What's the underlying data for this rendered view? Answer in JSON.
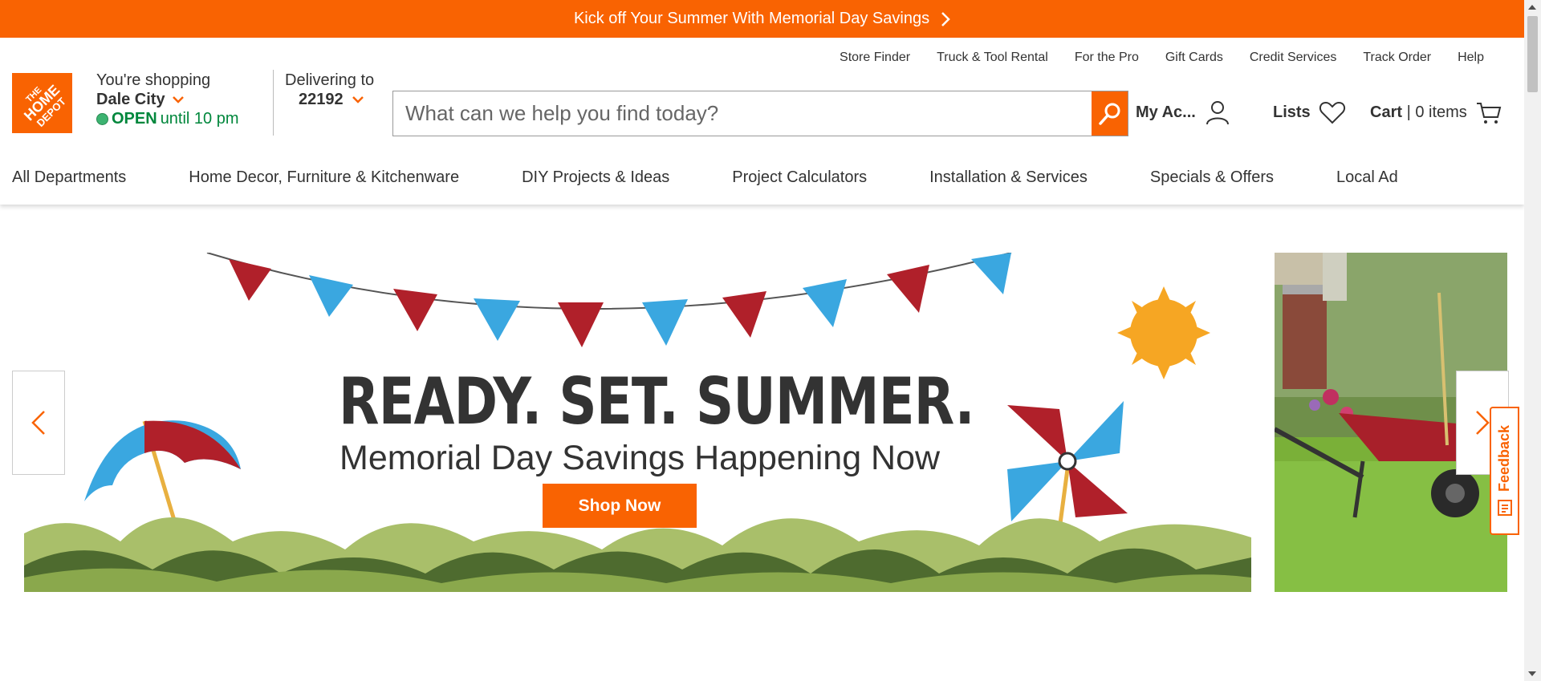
{
  "promo": {
    "text": "Kick off Your Summer With Memorial Day Savings",
    "icon": "chevron-right-icon"
  },
  "utility_links": [
    "Store Finder",
    "Truck & Tool Rental",
    "For the Pro",
    "Gift Cards",
    "Credit Services",
    "Track Order",
    "Help"
  ],
  "logo": {
    "line1": "THE",
    "line2": "HOME",
    "line3": "DEPOT"
  },
  "store": {
    "label": "You're shopping",
    "name": "Dale City",
    "status": "OPEN",
    "hours": "until 10 pm"
  },
  "delivery": {
    "label": "Delivering to",
    "zip": "22192"
  },
  "search": {
    "placeholder": "What can we help you find today?"
  },
  "account": {
    "my_account": "My Ac...",
    "lists": "Lists",
    "cart_label": "Cart",
    "cart_separator": "|",
    "cart_count": "0 items"
  },
  "nav": [
    "All Departments",
    "Home Decor, Furniture & Kitchenware",
    "DIY Projects & Ideas",
    "Project Calculators",
    "Installation & Services",
    "Specials & Offers",
    "Local Ad"
  ],
  "hero": {
    "headline": "READY. SET. SUMMER.",
    "subline": "Memorial Day Savings Happening Now",
    "cta": "Shop Now"
  },
  "feedback": {
    "label": "Feedback"
  },
  "colors": {
    "brand_orange": "#f96302",
    "open_green": "#00873c"
  }
}
